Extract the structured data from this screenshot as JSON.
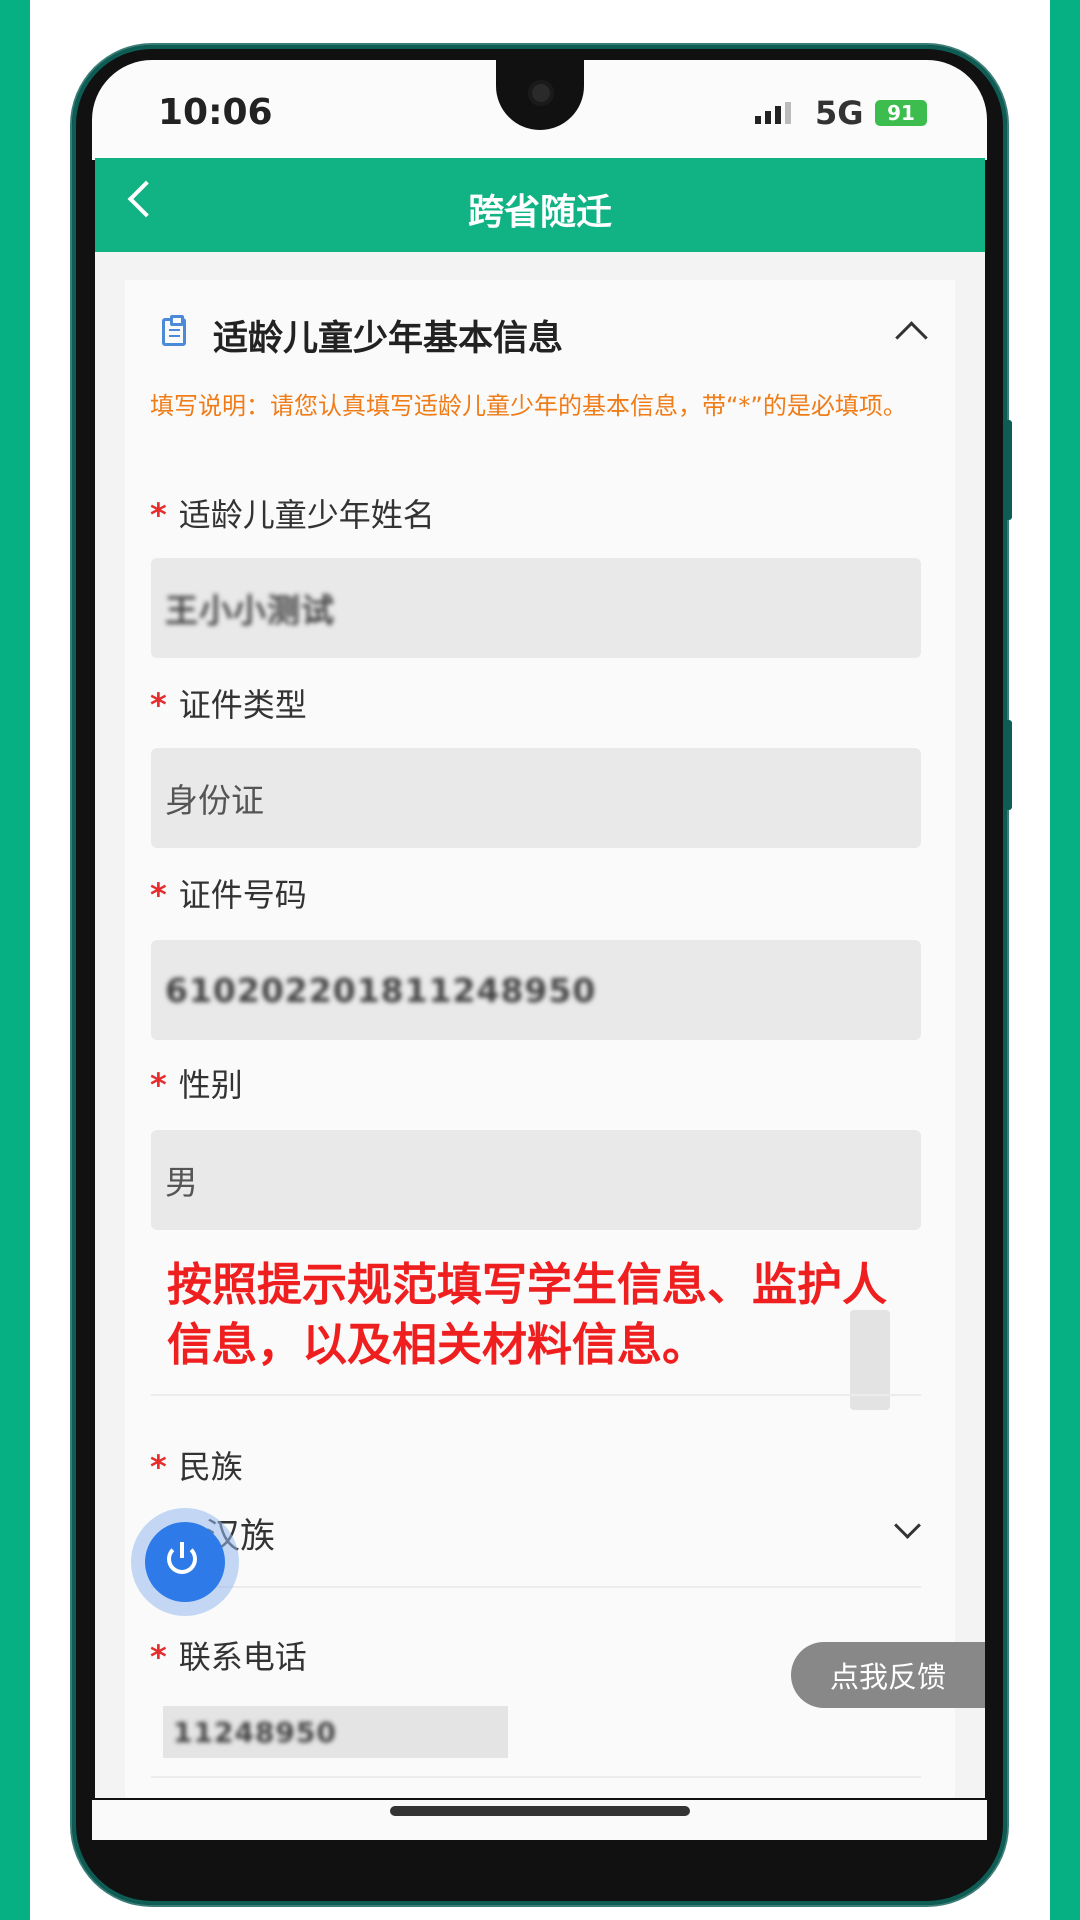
{
  "status_bar": {
    "time": "10:06",
    "network": "5G",
    "battery": "91"
  },
  "navbar": {
    "title": "跨省随迁"
  },
  "section": {
    "title": "适龄儿童少年基本信息",
    "note": "填写说明：请您认真填写适龄儿童少年的基本信息，带“*”的是必填项。"
  },
  "fields": {
    "name": {
      "required": "*",
      "label": "适龄儿童少年姓名",
      "value": "王小小测试"
    },
    "id_type": {
      "required": "*",
      "label": "证件类型",
      "value": "身份证"
    },
    "id_number": {
      "required": "*",
      "label": "证件号码",
      "value": "610202201811248950"
    },
    "gender": {
      "required": "*",
      "label": "性别",
      "value": "男"
    },
    "ethnicity": {
      "required": "*",
      "label": "民族",
      "value": "汉族"
    },
    "phone": {
      "required": "*",
      "label": "联系电话",
      "value": "11248950"
    }
  },
  "tip": "按照提示规范填写学生信息、监护人信息，以及相关材料信息。",
  "feedback_button": "点我反馈",
  "colors": {
    "brand": "#11b283",
    "frame": "#07b083",
    "note": "#f07c18",
    "tip": "#ef1f1f",
    "power": "#2d7ae8"
  }
}
